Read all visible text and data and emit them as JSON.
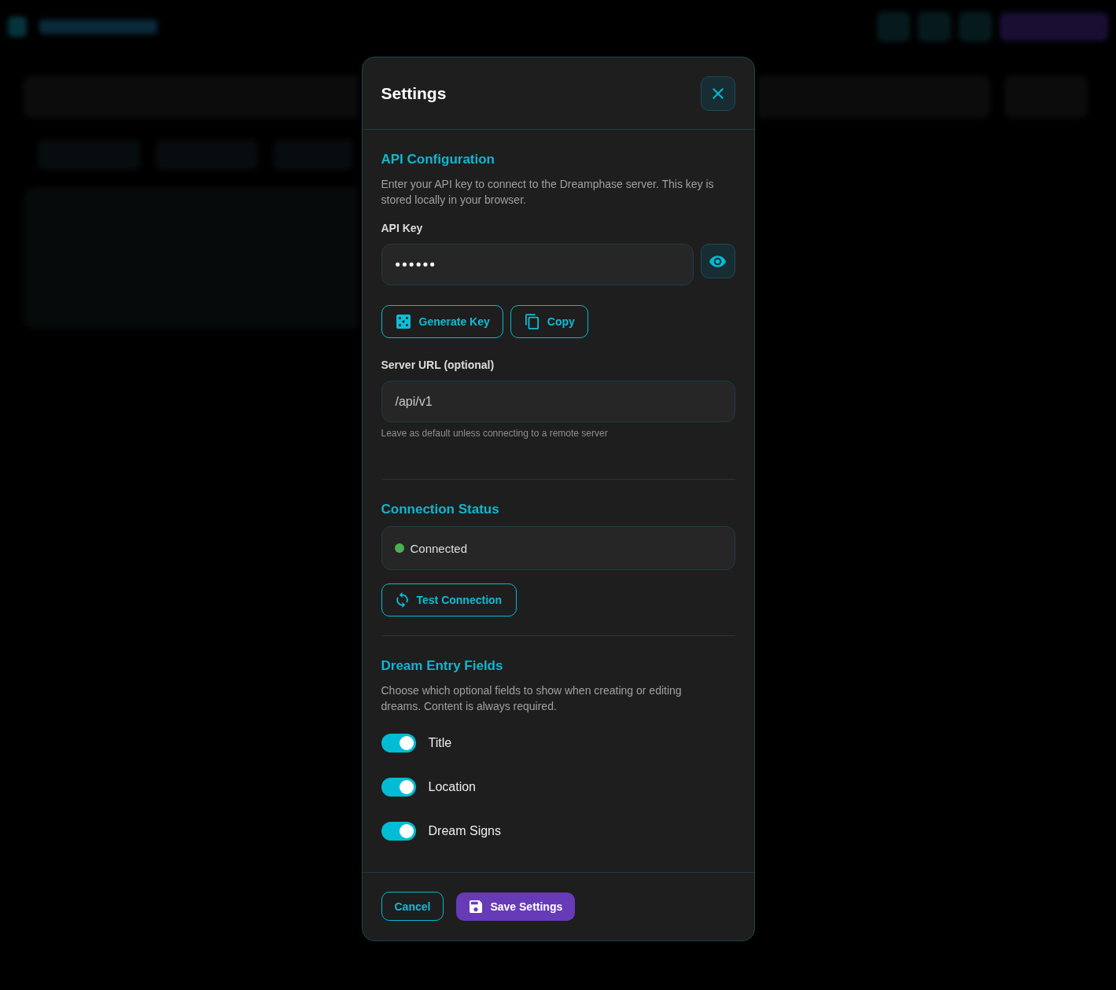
{
  "dialog": {
    "title": "Settings"
  },
  "api_configuration": {
    "heading": "API Configuration",
    "description": "Enter your API key to connect to the Dreamphase server. This key is stored locally in your browser.",
    "api_key": {
      "label": "API Key",
      "value": "••••••"
    },
    "actions": [
      {
        "kind": "generate",
        "label": "Generate Key"
      },
      {
        "kind": "copy",
        "label": "Copy"
      }
    ],
    "server_url": {
      "label": "Server URL (optional)",
      "value": "/api/v1",
      "hint": "Leave as default unless connecting to a remote server"
    }
  },
  "connection_status": {
    "heading": "Connection Status",
    "connected": true,
    "status_text": "Connected",
    "test_button": "Test Connection"
  },
  "dream_entry_fields": {
    "heading": "Dream Entry Fields",
    "description": "Choose which optional fields to show when creating or editing dreams. Content is always required.",
    "fields": [
      {
        "label": "Title",
        "on": true
      },
      {
        "label": "Location",
        "on": true
      },
      {
        "label": "Dream Signs",
        "on": true
      }
    ]
  },
  "footer": {
    "buttons": [
      {
        "kind": "secondary",
        "label": "Cancel"
      },
      {
        "kind": "primary",
        "label": "Save Settings"
      }
    ]
  }
}
